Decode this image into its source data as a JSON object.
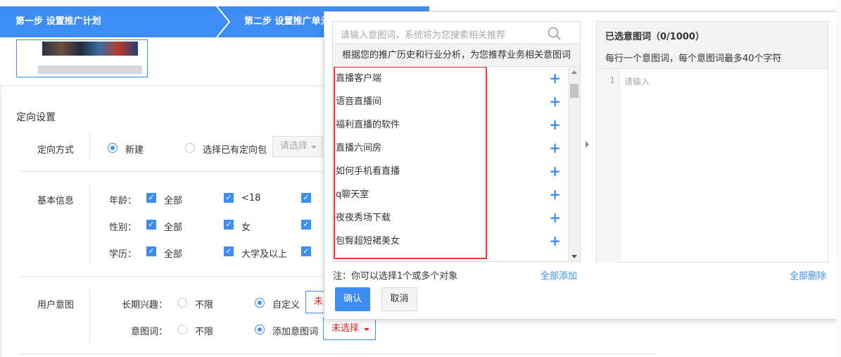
{
  "steps": {
    "step1": "第一步 设置推广计划",
    "step2": "第二步 设置推广单元"
  },
  "targeting": {
    "title": "定向设置",
    "method": {
      "label": "定向方式",
      "option_new": "新建",
      "option_existing": "选择已有定向包",
      "select_placeholder": "请选择"
    },
    "basic": {
      "label": "基本信息",
      "age_label": "年龄：",
      "age_options": [
        "全部",
        "<18"
      ],
      "gender_label": "性别：",
      "gender_options": [
        "全部",
        "女"
      ],
      "edu_label": "学历：",
      "edu_options": [
        "全部",
        "大学及以上"
      ]
    },
    "intent": {
      "label": "用户意图",
      "long_interest_label": "长期兴趣：",
      "unlimited": "不限",
      "custom": "自定义",
      "long_interest_value": "未",
      "keyword_label": "意图词：",
      "add_keywords": "添加意图词",
      "keyword_select": "未选择"
    }
  },
  "popup": {
    "search_placeholder": "请输入意图词，系统将为您搜索相关推荐",
    "hint": "根据您的推广历史和行业分析，为您推荐业务相关意图词",
    "suggestions": [
      "直播客户端",
      "语音直播间",
      "福利直播的软件",
      "直播六间房",
      "如何手机看直播",
      "q聊天室",
      "夜夜秀场下载",
      "包臀超短裙美女"
    ],
    "plus_symbol": "+",
    "note": "注：你可以选择1个或多个对象",
    "add_all": "全部添加",
    "confirm": "确认",
    "cancel": "取消",
    "selected_title": "已选意图词（0/1000）",
    "selected_rule": "每行一个意图词，每个意图词最多40个字符",
    "line_number": "1",
    "input_placeholder": "请输入",
    "delete_all": "全部删除"
  },
  "colors": {
    "accent": "#3d8df5",
    "highlight_box": "#e53e3e",
    "warning_text": "#e02424"
  }
}
